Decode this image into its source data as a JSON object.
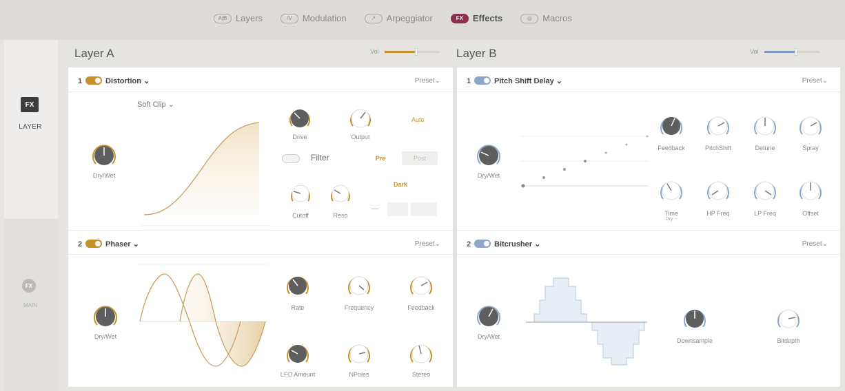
{
  "nav": [
    {
      "icon": "A|B",
      "icon_name": "layers-icon",
      "label": "Layers",
      "active": false
    },
    {
      "icon": "/V",
      "icon_name": "modulation-icon",
      "label": "Modulation",
      "active": false
    },
    {
      "icon": "↗",
      "icon_name": "arpeggiator-icon",
      "label": "Arpeggiator",
      "active": false
    },
    {
      "icon": "FX",
      "icon_name": "effects-icon",
      "label": "Effects",
      "active": true
    },
    {
      "icon": "◎",
      "icon_name": "macros-icon",
      "label": "Macros",
      "active": false
    }
  ],
  "sidebar": {
    "fx_badge": "FX",
    "layer_label": "LAYER",
    "main_badge": "FX",
    "main_label": "MAIN"
  },
  "layer_a": {
    "title": "Layer A",
    "vol_label": "Vol",
    "vol_level": 0.58,
    "accent": "#c8902a",
    "slot1": {
      "num": "1",
      "name": "Distortion",
      "preset": "Preset",
      "mode": "Soft Clip",
      "drywet": "Dry/Wet",
      "drive": "Drive",
      "output": "Output",
      "auto": "Auto",
      "filter": "Filter",
      "pre": "Pre",
      "post": "Post",
      "cutoff": "Cutoff",
      "reso": "Reso",
      "dark": "Dark"
    },
    "slot2": {
      "num": "2",
      "name": "Phaser",
      "preset": "Preset",
      "drywet": "Dry/Wet",
      "rate": "Rate",
      "frequency": "Frequency",
      "feedback": "Feedback",
      "lfo_amount": "LFO Amount",
      "npoles": "NPoles",
      "stereo": "Stereo"
    }
  },
  "layer_b": {
    "title": "Layer B",
    "vol_label": "Vol",
    "vol_level": 0.58,
    "accent": "#7c9ac0",
    "slot1": {
      "num": "1",
      "name": "Pitch Shift Delay",
      "preset": "Preset",
      "drywet": "Dry/Wet",
      "feedback": "Feedback",
      "pitchshift": "PitchShift",
      "detune": "Detune",
      "spray": "Spray",
      "time": "Time",
      "time_sub": "Dry ~",
      "hp_freq": "HP Freq",
      "lp_freq": "LP Freq",
      "offset": "Offset"
    },
    "slot2": {
      "num": "2",
      "name": "Bitcrusher",
      "preset": "Preset",
      "drywet": "Dry/Wet",
      "downsample": "Downsample",
      "bitdepth": "Bitdepth"
    }
  }
}
